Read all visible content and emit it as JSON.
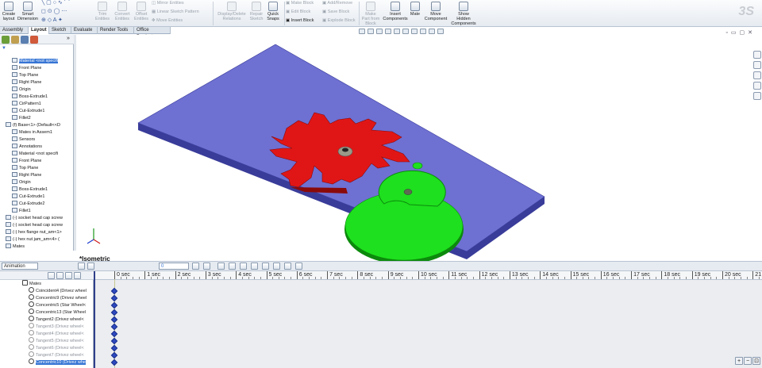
{
  "ribbon": {
    "create_layout": "Create\nlayout",
    "smart_dim": "Smart\nDimension",
    "trim_entities": "Trim\nEntities",
    "convert_entities": "Convert\nEntities",
    "offset_entities": "Offset\nEntities",
    "mirror_entities": "Mirror Entities",
    "linear_sketch_pattern": "Linear Sketch Pattern",
    "move_entities": "Move Entities",
    "display_delete_relations": "Display/Delete\nRelations",
    "repair_sketch": "Repair\nSketch",
    "quick_snaps": "Quick\nSnaps",
    "make_block": "Make Block",
    "edit_block": "Edit Block",
    "insert_block": "Insert Block",
    "add_remove": "Add/Remove",
    "save_block": "Save Block",
    "explode_block": "Explode Block",
    "make_part_from_block": "Make\nPart from\nBlock",
    "insert_components": "Insert\nComponents",
    "mate": "Mate",
    "move_component": "Move\nComponent",
    "show_hidden_components": "Show\nHidden\nComponents"
  },
  "tabs": [
    "Assembly",
    "Layout",
    "Sketch",
    "Evaluate",
    "Render Tools",
    "Office Products"
  ],
  "active_tab": "Layout",
  "tree": [
    {
      "label": "Material <not specifi",
      "sel": true
    },
    {
      "label": "Front Plane"
    },
    {
      "label": "Top Plane"
    },
    {
      "label": "Right Plane"
    },
    {
      "label": "Origin"
    },
    {
      "label": "Boss-Extrude1"
    },
    {
      "label": "CirPattern1"
    },
    {
      "label": "Cut-Extrude1"
    },
    {
      "label": "Fillet2"
    },
    {
      "label": "(f) Base<1> (Default<<D"
    },
    {
      "label": "Mates in Assem1"
    },
    {
      "label": "Sensors"
    },
    {
      "label": "Annotations"
    },
    {
      "label": "Material <not specifi"
    },
    {
      "label": "Front Plane"
    },
    {
      "label": "Top Plane"
    },
    {
      "label": "Right Plane"
    },
    {
      "label": "Origin"
    },
    {
      "label": "Boss-Extrude1"
    },
    {
      "label": "Cut-Extrude1"
    },
    {
      "label": "Cut-Extrude2"
    },
    {
      "label": "Fillet1"
    },
    {
      "label": "(-) socket head cap screw"
    },
    {
      "label": "(-) socket head cap screw"
    },
    {
      "label": "(-) hex flange nut_am<1>"
    },
    {
      "label": "(-) hex nut jam_am<4> ("
    },
    {
      "label": "Mates"
    }
  ],
  "view": {
    "label": "*Isometric",
    "colors": {
      "base": "#6e70d2",
      "base_side": "#3a3c9a",
      "star": "#e01616",
      "star_side": "#8a0a0a",
      "driver": "#1ee01e",
      "driver_side": "#0c8a0c",
      "hub": "#9a9a88"
    }
  },
  "animation": {
    "mode": "Animation",
    "time": "0",
    "mates_folder": "Mates",
    "mates": [
      {
        "label": "Coincident4 (Drivez wheel",
        "dim": false
      },
      {
        "label": "Concentric9 (Drivez wheel",
        "dim": false
      },
      {
        "label": "Concentric5 (Star Wheel<",
        "dim": false
      },
      {
        "label": "Concentric13 (Star Wheel",
        "dim": false
      },
      {
        "label": "Tangent2 (Drivez wheel<",
        "dim": false
      },
      {
        "label": "Tangent3 (Drivez wheel<",
        "dim": true
      },
      {
        "label": "Tangent4 (Drivez wheel<",
        "dim": true
      },
      {
        "label": "Tangent5 (Drivez wheel<",
        "dim": true
      },
      {
        "label": "Tangent6 (Drivez wheel<",
        "dim": true
      },
      {
        "label": "Tangent7 (Drivez wheel<",
        "dim": true
      },
      {
        "label": "Concentric10 (Drivez whe",
        "dim": false,
        "sel": true
      }
    ],
    "ticks": [
      "0 sec",
      "1 sec",
      "2 sec",
      "3 sec",
      "4 sec",
      "5 sec",
      "6 sec",
      "7 sec",
      "8 sec",
      "9 sec",
      "10 sec",
      "11 sec",
      "12 sec",
      "13 sec",
      "14 sec",
      "15 sec",
      "16 sec",
      "17 sec",
      "18 sec",
      "19 sec",
      "20 sec",
      "21"
    ]
  }
}
